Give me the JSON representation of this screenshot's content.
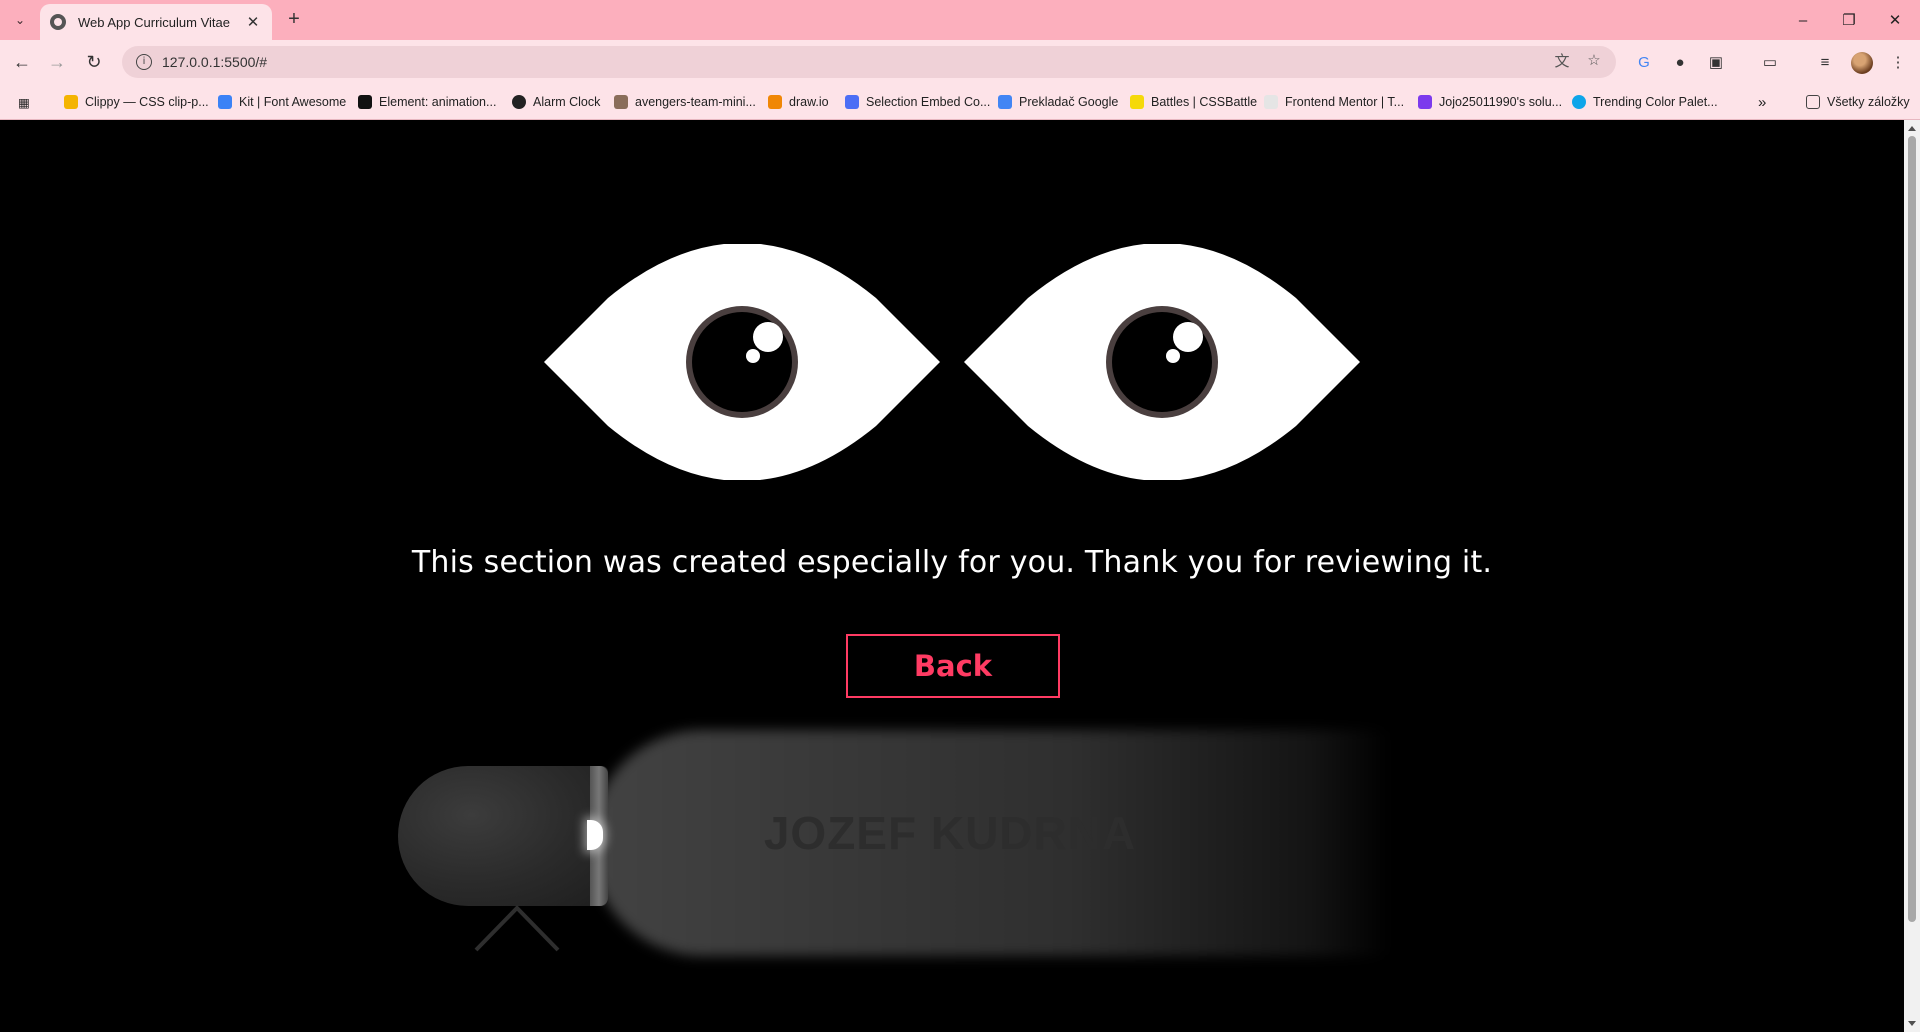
{
  "browser": {
    "tab_title": "Web App Curriculum Vitae",
    "url": "127.0.0.1:5500/#",
    "bookmarks": [
      {
        "label": "Clippy — CSS clip-p...",
        "color": "#f4b400"
      },
      {
        "label": "Kit | Font Awesome",
        "color": "#3b82f6"
      },
      {
        "label": "Element: animation...",
        "color": "#111111"
      },
      {
        "label": "Alarm Clock",
        "color": "#222222"
      },
      {
        "label": "avengers-team-mini...",
        "color": "#8a6d5a"
      },
      {
        "label": "draw.io",
        "color": "#f08705"
      },
      {
        "label": "Selection Embed Co...",
        "color": "#4c6ef5"
      },
      {
        "label": "Prekladač Google",
        "color": "#4285f4"
      },
      {
        "label": "Battles | CSSBattle",
        "color": "#f5d90a"
      },
      {
        "label": "Frontend Mentor | T...",
        "color": "#e5e5e5"
      },
      {
        "label": "Jojo25011990's solu...",
        "color": "#7c3aed"
      },
      {
        "label": "Trending Color Palet...",
        "color": "#0ea5e9"
      }
    ],
    "all_bookmarks_label": "Všetky záložky"
  },
  "page": {
    "message": "This section was created especially for you. Thank you for reviewing it.",
    "back_label": "Back",
    "flashlight_text": "JOZEF KUDRNA",
    "accent_color": "#ff3b63"
  }
}
